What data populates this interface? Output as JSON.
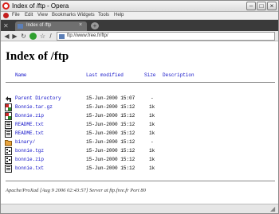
{
  "window": {
    "title": "Index of /ftp - Opera"
  },
  "menubar": {
    "items": [
      "File",
      "Edit",
      "View",
      "Bookmarks",
      "Widgets",
      "Tools",
      "Help"
    ]
  },
  "tabs": [
    {
      "label": "Index of /ftp"
    }
  ],
  "address": {
    "url": "ftp://www.free.fr/ftp/"
  },
  "page": {
    "heading": "Index of /ftp",
    "columns": {
      "name": "Name",
      "modified": "Last modified",
      "size": "Size",
      "description": "Description"
    },
    "rows": [
      {
        "icon": "parent-dir-icon",
        "name": "Parent Directory",
        "modified": "15-Jun-2000 15:07",
        "size": "-"
      },
      {
        "icon": "compressed-file-icon",
        "name": "Bonnie.tar.gz",
        "modified": "15-Jun-2000 15:12",
        "size": "1k"
      },
      {
        "icon": "compressed-file-icon",
        "name": "Bonnie.zip",
        "modified": "15-Jun-2000 15:12",
        "size": "1k"
      },
      {
        "icon": "text-file-icon",
        "name": "README.txt",
        "modified": "15-Jun-2000 15:12",
        "size": "1k"
      },
      {
        "icon": "text-file-icon",
        "name": "README.txt",
        "modified": "15-Jun-2000 15:12",
        "size": "1k"
      },
      {
        "icon": "folder-icon",
        "name": "binary/",
        "modified": "15-Jun-2000 15:12",
        "size": "-"
      },
      {
        "icon": "binary-file-icon",
        "name": "bonnie.tgz",
        "modified": "15-Jun-2000 15:12",
        "size": "1k"
      },
      {
        "icon": "binary-file-icon",
        "name": "bonnie.zip",
        "modified": "15-Jun-2000 15:12",
        "size": "1k"
      },
      {
        "icon": "text-file-icon",
        "name": "bonnie.txt",
        "modified": "15-Jun-2000 15:12",
        "size": "1k"
      }
    ],
    "footer": "Apache/ProXad [Aug 9 2006 02:43:57] Server at ftp.free.fr Port 80"
  }
}
